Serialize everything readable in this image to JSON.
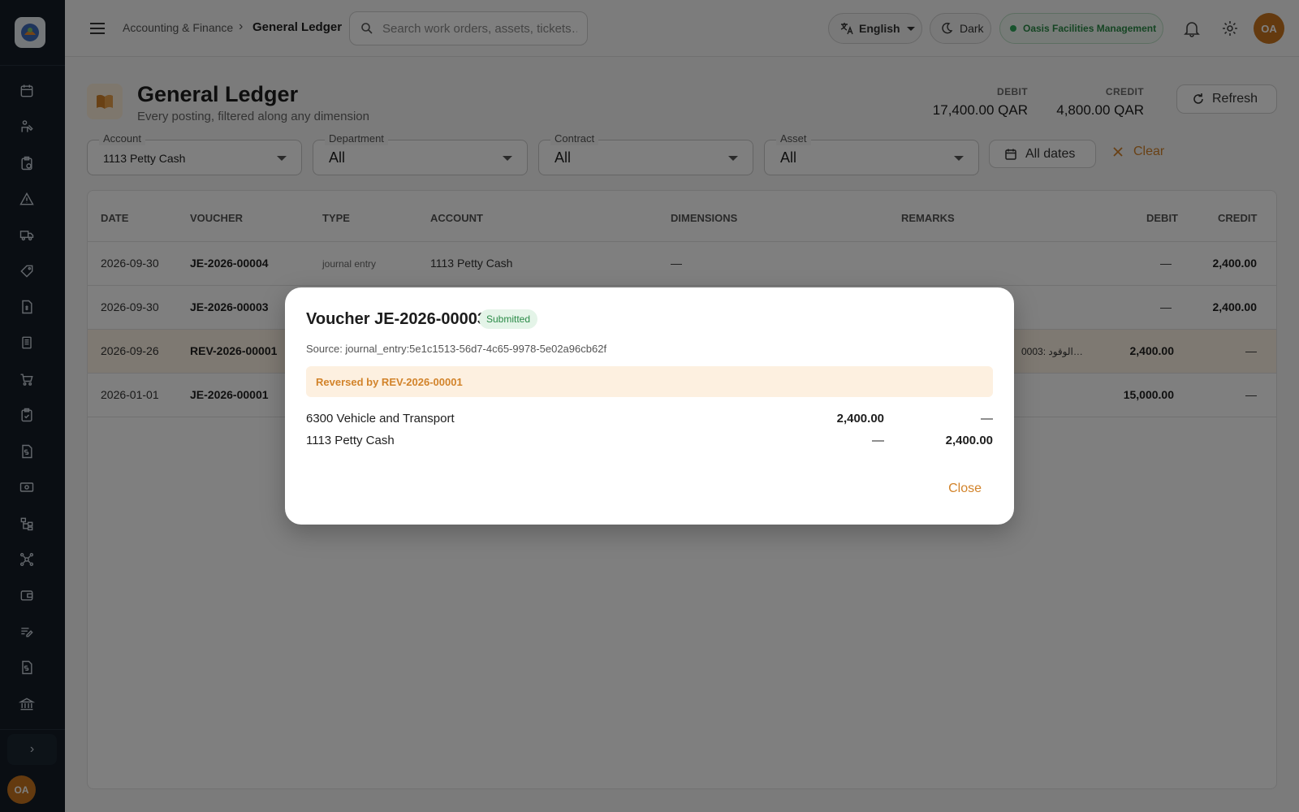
{
  "sidebar": {
    "icons": [
      "calendar-icon",
      "tools-icon",
      "clipboard-icon",
      "warning-icon",
      "truck-icon",
      "tag-icon",
      "invoice-icon",
      "book-icon",
      "cart-icon",
      "checklist-icon",
      "document-dollar-icon",
      "cash-icon",
      "hierarchy-icon",
      "network-icon",
      "wallet-icon",
      "edit-list-icon",
      "receipt-icon",
      "bank-icon"
    ],
    "avatar_initials": "OA",
    "expand_glyph": "›"
  },
  "topbar": {
    "breadcrumb_parent": "Accounting & Finance",
    "breadcrumb_sep": "›",
    "breadcrumb_current": "General Ledger",
    "search_placeholder": "Search work orders, assets, tickets…",
    "language": "English",
    "theme": "Dark",
    "organization": "Oasis Facilities Management",
    "avatar_initials": "OA"
  },
  "header": {
    "title": "General Ledger",
    "subtitle": "Every posting, filtered along any dimension",
    "debit_label": "DEBIT",
    "debit_value": "17,400.00 QAR",
    "credit_label": "CREDIT",
    "credit_value": "4,800.00 QAR",
    "refresh_label": "Refresh"
  },
  "filters": {
    "account_label": "Account",
    "account_value": "1113  Petty Cash",
    "department_label": "Department",
    "department_value": "All",
    "contract_label": "Contract",
    "contract_value": "All",
    "asset_label": "Asset",
    "asset_value": "All",
    "dates_label": "All dates",
    "clear_label": "Clear"
  },
  "table": {
    "headers": {
      "date": "DATE",
      "voucher": "VOUCHER",
      "type": "TYPE",
      "account": "ACCOUNT",
      "dimensions": "DIMENSIONS",
      "remarks": "REMARKS",
      "debit": "DEBIT",
      "credit": "CREDIT"
    },
    "rows": [
      {
        "date": "2026-09-30",
        "voucher": "JE-2026-00004",
        "type": "journal entry",
        "account": "1113  Petty Cash",
        "dimensions": "—",
        "remarks": "",
        "debit": "—",
        "credit": "2,400.00"
      },
      {
        "date": "2026-09-30",
        "voucher": "JE-2026-00003",
        "type": "",
        "account": "",
        "dimensions": "",
        "remarks": "",
        "debit": "—",
        "credit": "2,400.00"
      },
      {
        "date": "2026-09-26",
        "voucher": "REV-2026-00001",
        "type": "",
        "account": "",
        "dimensions": "",
        "remarks": "0003:  الوقود…",
        "debit": "2,400.00",
        "credit": "—"
      },
      {
        "date": "2026-01-01",
        "voucher": "JE-2026-00001",
        "type": "",
        "account": "",
        "dimensions": "",
        "remarks": "",
        "debit": "15,000.00",
        "credit": "—"
      }
    ]
  },
  "modal": {
    "title": "Voucher JE-2026-00003",
    "status": "Submitted",
    "source": "Source: journal_entry:5e1c1513-56d7-4c65-9978-5e02a96cb62f",
    "alert": "Reversed by REV-2026-00001",
    "lines": [
      {
        "account": "6300  Vehicle and Transport",
        "debit": "2,400.00",
        "credit": "—"
      },
      {
        "account": "1113  Petty Cash",
        "debit": "—",
        "credit": "2,400.00"
      }
    ],
    "close_label": "Close"
  },
  "colors": {
    "accent": "#d2832a",
    "sidebar_bg": "#141d27",
    "success": "#2a8a47",
    "row_highlight": "#fdf3e4"
  }
}
